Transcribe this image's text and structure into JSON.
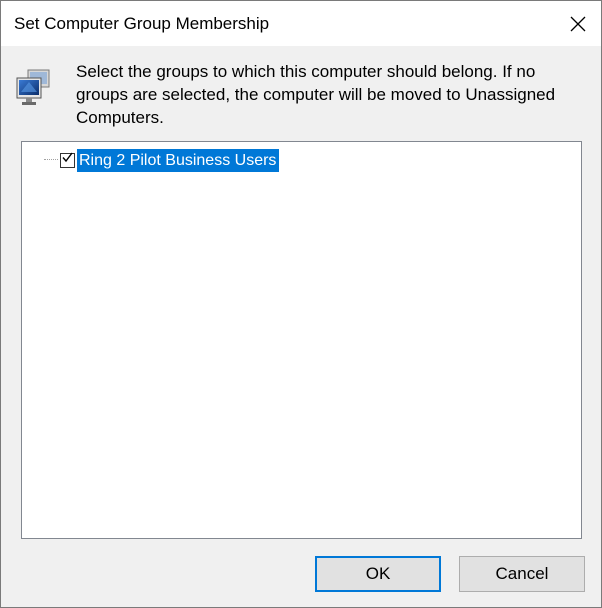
{
  "window": {
    "title": "Set Computer Group Membership"
  },
  "dialog": {
    "description": "Select the groups to which this computer should belong. If no groups are selected, the computer will be moved to Unassigned Computers.",
    "icon": "computer-monitor-icon"
  },
  "groups": {
    "items": [
      {
        "label": "Ring 2 Pilot Business Users",
        "checked": true,
        "selected": true
      }
    ]
  },
  "buttons": {
    "ok_label": "OK",
    "cancel_label": "Cancel"
  },
  "colors": {
    "selection": "#0078d7",
    "dialog_background": "#f0f0f0",
    "default_button_border": "#0078d7"
  }
}
